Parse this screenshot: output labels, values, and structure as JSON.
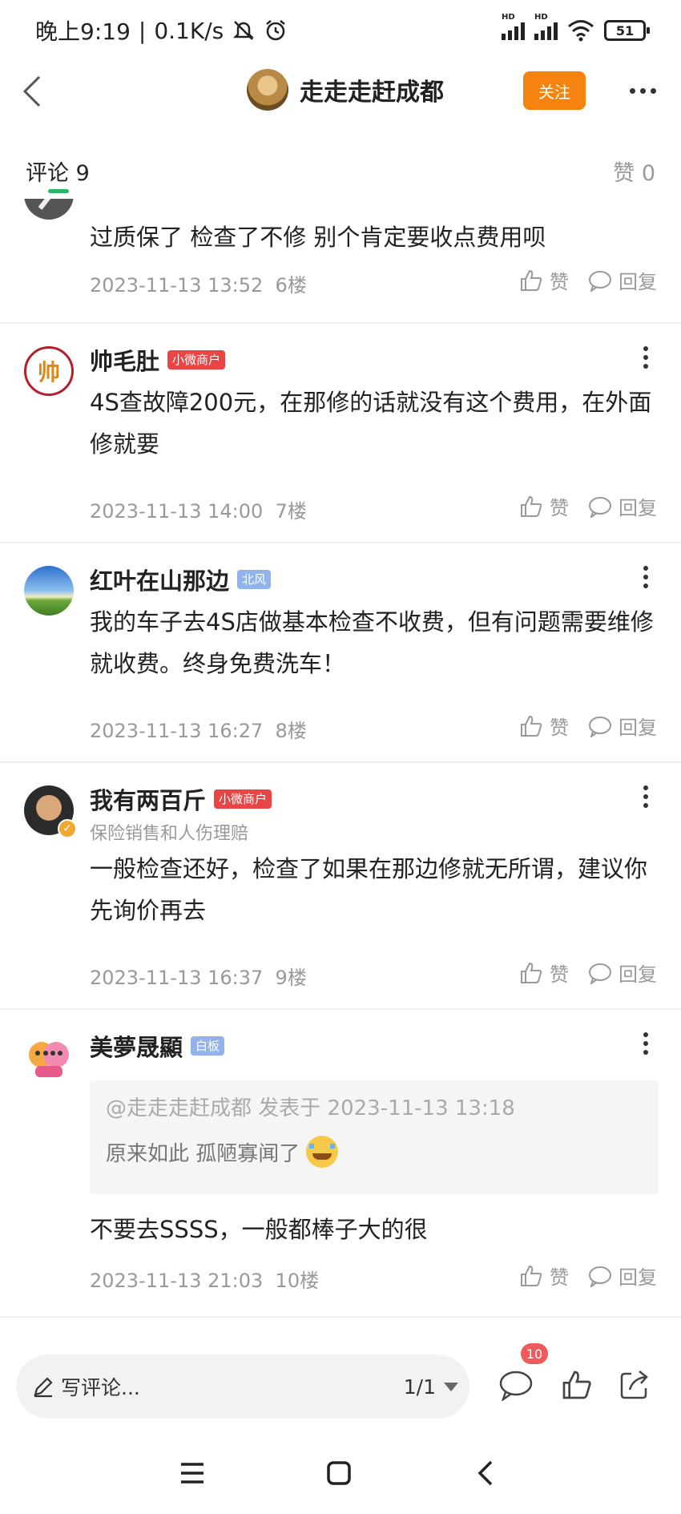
{
  "status_bar": {
    "time": "晚上9:19",
    "speed": "0.1K/s",
    "hd1": "HD",
    "hd2": "HD",
    "battery": "51"
  },
  "header": {
    "title": "走走走赶成都",
    "follow_label": "关注"
  },
  "tabs": {
    "comments_label": "评论 9",
    "likes_label": "赞 0"
  },
  "comments": [
    {
      "text": "过质保了  检查了不修  别个肯定要收点费用呗",
      "time": "2023-11-13 13:52",
      "floor": "6楼",
      "like": "赞",
      "reply": "回复"
    },
    {
      "name": "帅毛肚",
      "badge": "小微商户",
      "avatar_glyph": "帅",
      "text": "4S查故障200元，在那修的话就没有这个费用，在外面修就要",
      "time": "2023-11-13 14:00",
      "floor": "7楼",
      "like": "赞",
      "reply": "回复"
    },
    {
      "name": "红叶在山那边",
      "badge": "北风",
      "text": "我的车子去4S店做基本检查不收费，但有问题需要维修就收费。终身免费洗车！",
      "time": "2023-11-13 16:27",
      "floor": "8楼",
      "like": "赞",
      "reply": "回复"
    },
    {
      "name": "我有两百斤",
      "badge": "小微商户",
      "subtitle": "保险销售和人伤理赔",
      "text": "一般检查还好，检查了如果在那边修就无所谓，建议你先询价再去",
      "time": "2023-11-13 16:37",
      "floor": "9楼",
      "like": "赞",
      "reply": "回复"
    },
    {
      "name": "美夢晟顯",
      "badge": "白板",
      "quote_head": "@走走走赶成都 发表于 2023-11-13 13:18",
      "quote_text": "原来如此  孤陋寡闻了",
      "text": "不要去SSSS，一般都棒子大的很",
      "time": "2023-11-13 21:03",
      "floor": "10楼",
      "like": "赞",
      "reply": "回复"
    }
  ],
  "bottom_bar": {
    "write_placeholder": "写评论...",
    "page_indicator": "1/1",
    "comment_count": "10"
  },
  "colors": {
    "accent_orange": "#f6830f",
    "tab_underline_green": "#2bb56b",
    "badge_red": "#e94545",
    "badge_blue": "#8fb3ea"
  }
}
